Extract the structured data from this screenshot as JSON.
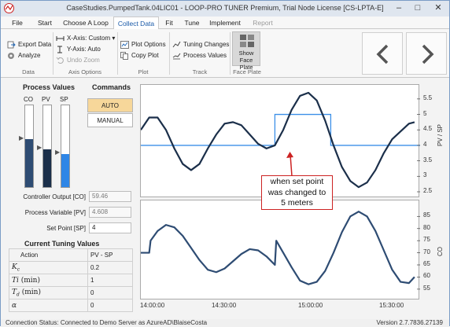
{
  "window": {
    "title": "CaseStudies.PumpedTank.04LIC01 - LOOP-PRO TUNER Premium, Trial Node License [CS-LPTA-E]"
  },
  "menu": {
    "tabs": [
      "File",
      "Start",
      "Choose A Loop",
      "Collect Data",
      "Fit",
      "Tune",
      "Implement",
      "Report"
    ],
    "active": "Collect Data"
  },
  "ribbon": {
    "data": {
      "export": "Export Data",
      "analyze": "Analyze",
      "label": "Data"
    },
    "axis": {
      "xaxis": "X-Axis: Custom",
      "yaxis": "Y-Axis: Auto",
      "undo": "Undo Zoom",
      "label": "Axis Options"
    },
    "plot": {
      "options": "Plot Options",
      "copy": "Copy Plot",
      "label": "Plot"
    },
    "track": {
      "changes": "Tuning Changes",
      "values": "Process Values",
      "label": "Track"
    },
    "faceplate": {
      "line1": "Show",
      "line2": "Face Plate",
      "label": "Face Plate"
    }
  },
  "process_values": {
    "title": "Process Values",
    "headers": [
      "CO",
      "PV",
      "SP"
    ],
    "fills": [
      0.59,
      0.46,
      0.4
    ],
    "colors": [
      "#2e4c73",
      "#1b2f4a",
      "#2f86e6"
    ]
  },
  "commands": {
    "title": "Commands",
    "auto": "AUTO",
    "manual": "MANUAL",
    "active_color": "#f7d79a"
  },
  "fields": {
    "co": {
      "label": "Controller Output [CO]",
      "value": "59.46"
    },
    "pv": {
      "label": "Process Variable [PV]",
      "value": "4.608"
    },
    "sp": {
      "label": "Set Point [SP]",
      "value": "4"
    }
  },
  "tuning": {
    "title": "Current Tuning Values",
    "col1": "Action",
    "col2": "PV - SP",
    "rows": [
      {
        "name": "K",
        "sub": "c",
        "unit": "",
        "value": "0.2"
      },
      {
        "name": "Ti",
        "sub": "",
        "unit": " (min)",
        "value": "1"
      },
      {
        "name": "T",
        "sub": "d",
        "unit": " (min)",
        "value": "0"
      },
      {
        "name": "α",
        "sub": "",
        "unit": "",
        "value": "0"
      }
    ]
  },
  "chart_data": [
    {
      "type": "line",
      "ylabel": "PV / SP",
      "ylim": [
        2.5,
        5.75
      ],
      "yticks": [
        "5.5",
        "5",
        "4.5",
        "4",
        "3.5",
        "3",
        "2.5"
      ],
      "x": [
        "14:00:00",
        "14:30:00",
        "15:00:00",
        "15:30:00"
      ],
      "series": [
        {
          "name": "PV",
          "color": "#1b2f4a",
          "x": [
            0,
            3,
            6,
            9,
            12,
            15,
            18,
            21,
            24,
            27,
            30,
            33,
            36,
            39,
            42,
            45,
            48,
            51,
            54,
            57,
            60,
            63,
            66,
            69,
            72,
            75,
            78,
            81,
            84,
            87,
            90,
            93,
            96,
            98
          ],
          "y": [
            4.5,
            4.9,
            4.9,
            4.5,
            3.9,
            3.4,
            3.2,
            3.4,
            3.9,
            4.35,
            4.7,
            4.75,
            4.65,
            4.35,
            4.05,
            3.9,
            4.0,
            4.5,
            5.15,
            5.6,
            5.7,
            5.45,
            4.8,
            4.0,
            3.3,
            2.85,
            2.65,
            2.8,
            3.2,
            3.75,
            4.2,
            4.45,
            4.7,
            4.75
          ]
        }
      ],
      "sp": {
        "name": "SP",
        "color": "#3b8fe8",
        "segments": [
          [
            0,
            4.0
          ],
          [
            48,
            4.0
          ],
          [
            48,
            5.0
          ],
          [
            68,
            5.0
          ],
          [
            68,
            4.0
          ],
          [
            100,
            4.0
          ]
        ]
      }
    },
    {
      "type": "line",
      "ylabel": "CO",
      "ylim": [
        53,
        89
      ],
      "yticks": [
        "85",
        "80",
        "75",
        "70",
        "65",
        "60",
        "55"
      ],
      "x": [
        "14:00:00",
        "14:30:00",
        "15:00:00",
        "15:30:00"
      ],
      "series": [
        {
          "name": "CO",
          "color": "#2e4c73",
          "x": [
            0,
            3,
            3.5,
            6,
            9,
            12,
            15,
            18,
            21,
            24,
            27,
            30,
            33,
            36,
            39,
            42,
            45,
            48,
            48.5,
            51,
            54,
            57,
            60,
            63,
            66,
            69,
            72,
            75,
            78,
            81,
            84,
            87,
            90,
            93,
            96,
            98
          ],
          "y": [
            70,
            70,
            75,
            79,
            81.5,
            80.5,
            77,
            72,
            67,
            63,
            62,
            63.5,
            66.5,
            69.5,
            71.5,
            71,
            68.5,
            65,
            75,
            70,
            64,
            58.5,
            57,
            58,
            62.5,
            70,
            78.5,
            85,
            87,
            85,
            79,
            71,
            63,
            58,
            57.5,
            60
          ]
        }
      ]
    }
  ],
  "annotation": {
    "line1": "when set point",
    "line2": "was changed to",
    "line3": "5 meters"
  },
  "status": {
    "left": "Connection Status: Connected to Demo Server as AzureAD\\BlaiseCosta",
    "right": "Version 2.7.7836.27139"
  }
}
